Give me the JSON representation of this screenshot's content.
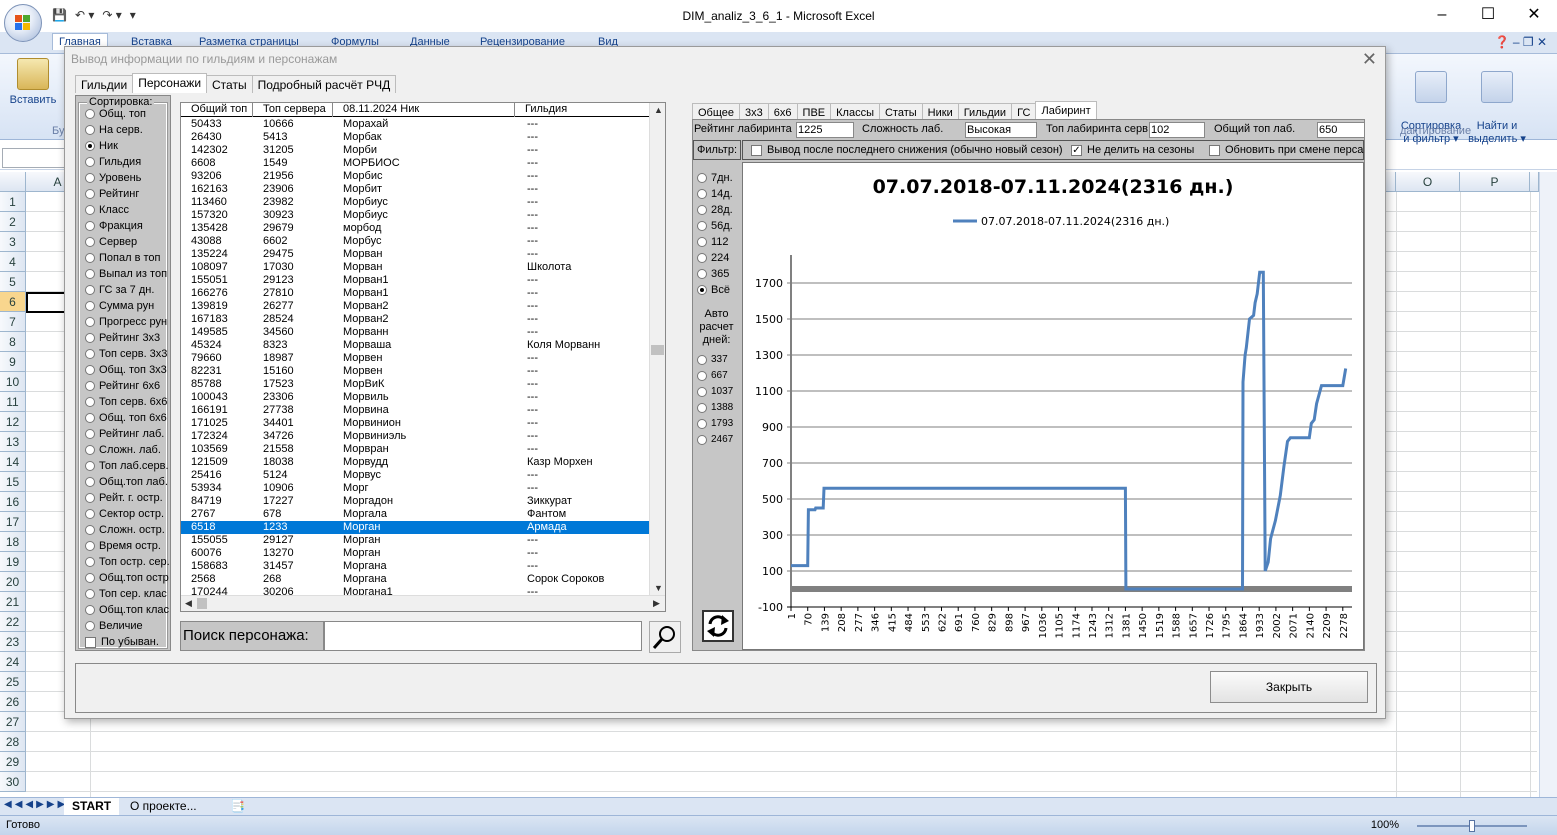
{
  "excel": {
    "title": "DIM_analiz_3_6_1 - Microsoft Excel",
    "ribbon_tabs": [
      "Главная",
      "Вставка",
      "Разметка страницы",
      "Формулы",
      "Данные",
      "Рецензирование",
      "Вид"
    ],
    "ribbon_left": {
      "paste_label": "Вставить",
      "caption": "Бу"
    },
    "ribbon_right": {
      "sort_label": "Сортировка\nи фильтр ▾",
      "find_label": "Найти и\nвыделить ▾",
      "caption": "дактирование"
    },
    "columns": [
      "A",
      "O",
      "P"
    ],
    "rows": [
      "1",
      "2",
      "3",
      "4",
      "5",
      "6",
      "7",
      "8",
      "9",
      "10",
      "11",
      "12",
      "13",
      "14",
      "15",
      "16",
      "17",
      "18",
      "19",
      "20",
      "21",
      "22",
      "23",
      "24",
      "25",
      "26",
      "27",
      "28",
      "29",
      "30"
    ],
    "selected_row": "6",
    "sheet_tabs": [
      "START",
      "О проекте..."
    ],
    "status": "Готово",
    "zoom": "100%"
  },
  "dialog": {
    "title": "Вывод информации по гильдиям и персонажам",
    "main_tabs": [
      "Гильдии",
      "Персонажи",
      "Статы",
      "Подробный расчёт РЧД"
    ],
    "active_main_tab": 1,
    "sort": {
      "legend": "Сортировка:",
      "options": [
        "Общ. топ",
        "На серв.",
        "Ник",
        "Гильдия",
        "Уровень",
        "Рейтинг",
        "Класс",
        "Фракция",
        "Сервер",
        "Попал в топ",
        "Выпал из топ",
        "ГС за 7 дн.",
        "Сумма рун",
        "Прогресс рун",
        "Рейтинг 3х3",
        "Топ серв. 3х3",
        "Общ. топ 3х3",
        "Рейтинг 6х6",
        "Топ серв. 6х6",
        "Общ. топ 6х6",
        "Рейтинг лаб.",
        "Сложн. лаб.",
        "Топ лаб.серв.",
        "Общ.топ лаб.",
        "Рейт. г. остр.",
        "Сектор остр.",
        "Сложн. остр.",
        "Время остр.",
        "Топ остр. сер.",
        "Общ.топ остр",
        "Топ сер. клас",
        "Общ.топ клас",
        "Величие"
      ],
      "selected": 2,
      "desc_label": "По убыван."
    },
    "list": {
      "headers": [
        "Общий топ",
        "Топ сервера",
        "08.11.2024 Ник",
        "Гильдия"
      ],
      "rows": [
        [
          "50433",
          "10666",
          "Морахай",
          "---"
        ],
        [
          "26430",
          "5413",
          "Морбак",
          "---"
        ],
        [
          "142302",
          "31205",
          "Морби",
          "---"
        ],
        [
          "6608",
          "1549",
          "МОРБИОС",
          "---"
        ],
        [
          "93206",
          "21956",
          "Морбис",
          "---"
        ],
        [
          "162163",
          "23906",
          "Морбит",
          "---"
        ],
        [
          "113460",
          "23982",
          "Морбиус",
          "---"
        ],
        [
          "157320",
          "30923",
          "Морбиус",
          "---"
        ],
        [
          "135428",
          "29679",
          "морбод",
          "---"
        ],
        [
          "43088",
          "6602",
          "Морбус",
          "---"
        ],
        [
          "135224",
          "29475",
          "Морван",
          "---"
        ],
        [
          "108097",
          "17030",
          "Морван",
          "Школота"
        ],
        [
          "155051",
          "29123",
          "Морван1",
          "---"
        ],
        [
          "166276",
          "27810",
          "Морван1",
          "---"
        ],
        [
          "139819",
          "26277",
          "Морван2",
          "---"
        ],
        [
          "167183",
          "28524",
          "Морван2",
          "---"
        ],
        [
          "149585",
          "34560",
          "Морванн",
          "---"
        ],
        [
          "45324",
          "8323",
          "Морваша",
          "Коля Морванн"
        ],
        [
          "79660",
          "18987",
          "Морвен",
          "---"
        ],
        [
          "82231",
          "15160",
          "Морвен",
          "---"
        ],
        [
          "85788",
          "17523",
          "МорВиК",
          "---"
        ],
        [
          "100043",
          "23306",
          "Морвиль",
          "---"
        ],
        [
          "166191",
          "27738",
          "Морвина",
          "---"
        ],
        [
          "171025",
          "34401",
          "Морвинион",
          "---"
        ],
        [
          "172324",
          "34726",
          "Морвиниэль",
          "---"
        ],
        [
          "103569",
          "21558",
          "Морвран",
          "---"
        ],
        [
          "121509",
          "18038",
          "Морвудд",
          "Казр Морхен"
        ],
        [
          "25416",
          "5124",
          "Морвус",
          "---"
        ],
        [
          "53934",
          "10906",
          "Морг",
          "---"
        ],
        [
          "84719",
          "17227",
          "Моргадон",
          "Зиккурат"
        ],
        [
          "2767",
          "678",
          "Моргала",
          "Фантом"
        ],
        [
          "6518",
          "1233",
          "Морган",
          "Армада"
        ],
        [
          "155055",
          "29127",
          "Морган",
          "---"
        ],
        [
          "60076",
          "13270",
          "Морган",
          "---"
        ],
        [
          "158683",
          "31457",
          "Моргана",
          "---"
        ],
        [
          "2568",
          "268",
          "Моргана",
          "Сорок Сороков"
        ],
        [
          "170244",
          "30206",
          "Моргана1",
          "---"
        ]
      ],
      "selected_index": 31
    },
    "search": {
      "label": "Поиск персонажа:",
      "value": ""
    },
    "sub_tabs": [
      "Общее",
      "3х3",
      "6х6",
      "ПВЕ",
      "Классы",
      "Статы",
      "Ники",
      "Гильдии",
      "ГС",
      "Лабиринт"
    ],
    "active_sub_tab": 9,
    "stats": [
      {
        "label": "Рейтинг лабиринта",
        "value": "1225"
      },
      {
        "label": "Сложность лаб.",
        "value": "Высокая"
      },
      {
        "label": "Топ лабиринта серв",
        "value": "102"
      },
      {
        "label": "Общий топ лаб.",
        "value": "650"
      }
    ],
    "filter": {
      "label": "Фильтр:",
      "options": [
        {
          "label": "Вывод после последнего снижения (обычно новый сезон)",
          "checked": false
        },
        {
          "label": "Не делить на сезоны",
          "checked": true
        },
        {
          "label": "Обновить при смене перса",
          "checked": false
        }
      ]
    },
    "periods": [
      "7дн.",
      "14д.",
      "28д.",
      "56д.",
      "112",
      "224",
      "365",
      "Всё"
    ],
    "selected_period": 7,
    "auto_label": "Авто расчет дней:",
    "auto_days": [
      "337",
      "667",
      "1037",
      "1388",
      "1793",
      "2467"
    ],
    "close_label": "Закрыть"
  },
  "chart_data": {
    "type": "line",
    "title": "07.07.2018-07.11.2024(2316 дн.)",
    "series": [
      {
        "name": "07.07.2018-07.11.2024(2316 дн.)",
        "color": "#4f81bd",
        "points": [
          [
            1,
            130
          ],
          [
            70,
            130
          ],
          [
            73,
            440
          ],
          [
            100,
            440
          ],
          [
            103,
            450
          ],
          [
            134,
            450
          ],
          [
            137,
            560
          ],
          [
            1381,
            560
          ],
          [
            1383,
            0
          ],
          [
            1864,
            0
          ],
          [
            1866,
            1150
          ],
          [
            1875,
            1300
          ],
          [
            1880,
            1340
          ],
          [
            1893,
            1500
          ],
          [
            1910,
            1520
          ],
          [
            1916,
            1590
          ],
          [
            1925,
            1640
          ],
          [
            1935,
            1760
          ],
          [
            1950,
            1760
          ],
          [
            1958,
            100
          ],
          [
            1970,
            150
          ],
          [
            1980,
            280
          ],
          [
            2000,
            380
          ],
          [
            2020,
            520
          ],
          [
            2035,
            680
          ],
          [
            2050,
            820
          ],
          [
            2062,
            840
          ],
          [
            2140,
            840
          ],
          [
            2148,
            920
          ],
          [
            2160,
            940
          ],
          [
            2170,
            1030
          ],
          [
            2190,
            1130
          ],
          [
            2278,
            1130
          ],
          [
            2290,
            1225
          ]
        ]
      }
    ],
    "x_ticks": [
      "1",
      "70",
      "139",
      "208",
      "277",
      "346",
      "415",
      "484",
      "553",
      "622",
      "691",
      "760",
      "829",
      "898",
      "967",
      "1036",
      "1105",
      "1174",
      "1243",
      "1312",
      "1381",
      "1450",
      "1519",
      "1588",
      "1657",
      "1726",
      "1795",
      "1864",
      "1933",
      "2002",
      "2071",
      "2140",
      "2209",
      "2278"
    ],
    "y_ticks": [
      "-100",
      "100",
      "300",
      "500",
      "700",
      "900",
      "1100",
      "1300",
      "1500",
      "1700"
    ],
    "ylim": [
      -100,
      1800
    ],
    "xlim": [
      1,
      2316
    ],
    "grid": true,
    "legend_position": "top"
  }
}
